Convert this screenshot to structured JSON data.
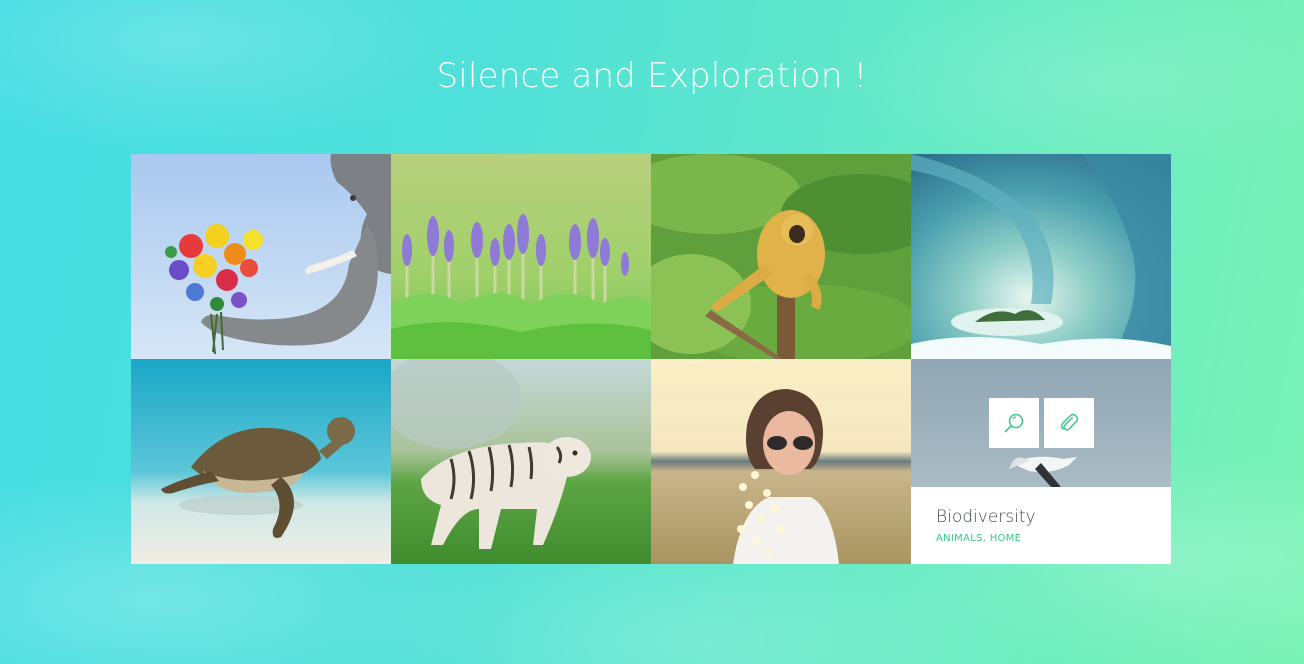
{
  "page": {
    "title": "Silence and Exploration !"
  },
  "colors": {
    "accent": "#3cc78a",
    "caption_title": "#444a50",
    "background_left": "#45dde3",
    "background_right": "#7af3b6"
  },
  "gallery": {
    "items": [
      {
        "subject": "elephant-with-flowers"
      },
      {
        "subject": "purple-crocus-flowers"
      },
      {
        "subject": "gibbon-on-post"
      },
      {
        "subject": "ocean-wave-tube"
      },
      {
        "subject": "sea-turtle"
      },
      {
        "subject": "white-tiger"
      },
      {
        "subject": "woman-with-sunglasses"
      },
      {
        "subject": "seagull",
        "hovered": true,
        "title": "Biodiversity",
        "categories": [
          "ANIMALS",
          "HOME"
        ],
        "separator": ", ",
        "actions": [
          {
            "icon": "search-icon"
          },
          {
            "icon": "paperclip-icon"
          }
        ]
      }
    ]
  }
}
